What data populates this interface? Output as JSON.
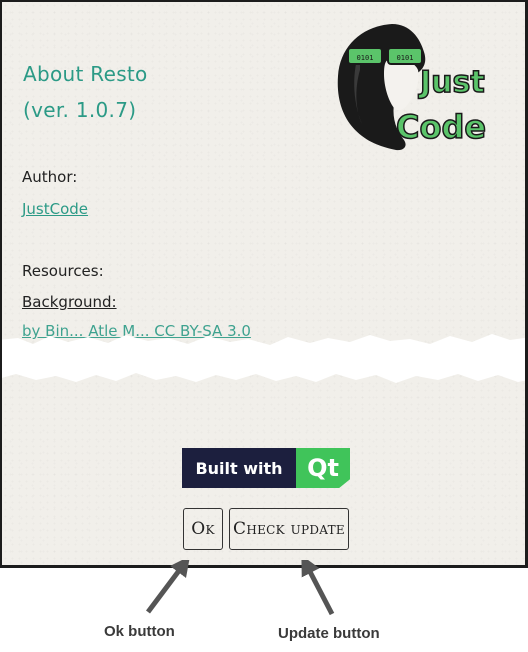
{
  "dialog": {
    "title_line1": "About Resto",
    "title_line2": "(ver. 1.0.7)",
    "author_label": "Author:",
    "author_link": "JustCode",
    "resources_label": "Resources:",
    "background_link": "Background:",
    "faded_resource_text": "by Bin... Atle M... CC BY-SA 3.0"
  },
  "logo": {
    "line1": "Just",
    "line2": "Code",
    "icon": "woman-with-sunglasses-logo"
  },
  "qt_badge": {
    "left_text": "Built with",
    "right_text": "Qt",
    "colors": {
      "dark": "#1c1f3e",
      "green": "#40c45a"
    }
  },
  "buttons": {
    "ok_label": "Ok",
    "update_label": "Check update"
  },
  "annotations": {
    "ok": "Ok button",
    "update": "Update button"
  },
  "colors": {
    "accent": "#2b9a86",
    "background": "#f1efea"
  }
}
